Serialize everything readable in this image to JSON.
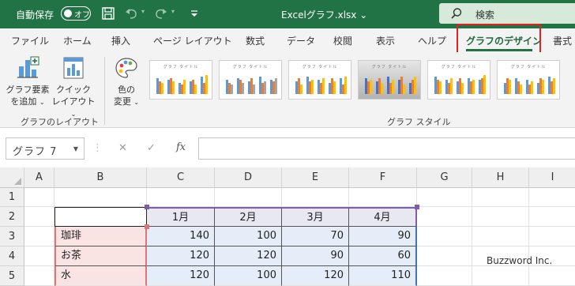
{
  "titlebar": {
    "autosave_label": "自動保存",
    "autosave_state": "オフ",
    "document_title": "Excelグラフ.xlsx",
    "title_chevron": "⌄",
    "search_label": "検索",
    "accent_color": "#217346"
  },
  "tabs": [
    {
      "label": "ファイル"
    },
    {
      "label": "ホーム"
    },
    {
      "label": "挿入"
    },
    {
      "label": "ページ レイアウト"
    },
    {
      "label": "数式"
    },
    {
      "label": "データ"
    },
    {
      "label": "校閲"
    },
    {
      "label": "表示"
    },
    {
      "label": "ヘルプ"
    },
    {
      "label": "グラフのデザイン",
      "active": true
    },
    {
      "label": "書式"
    }
  ],
  "ribbon": {
    "add_element_line1": "グラフ要素",
    "add_element_line2": "を追加",
    "quick_layout_line1": "クイック",
    "quick_layout_line2": "レイアウト",
    "change_colors_line1": "色の",
    "change_colors_line2": "変更",
    "group_layout_label": "グラフのレイアウト",
    "group_style_label": "グラフ スタイル",
    "style_thumb_title": "グラフ タイトル"
  },
  "formula_bar": {
    "name_box": "グラフ 7",
    "cancel_symbol": "✕",
    "enter_symbol": "✓",
    "fx_label": "fx",
    "formula_value": ""
  },
  "sheet": {
    "columns": [
      "A",
      "B",
      "C",
      "D",
      "E",
      "F",
      "G",
      "H",
      "I"
    ],
    "rows": [
      "1",
      "2",
      "3",
      "4",
      "5"
    ],
    "header_row": [
      "",
      "1月",
      "2月",
      "3月",
      "4月"
    ],
    "data": [
      {
        "label": "珈琲",
        "values": [
          "140",
          "100",
          "70",
          "90"
        ]
      },
      {
        "label": "お茶",
        "values": [
          "120",
          "120",
          "90",
          "60"
        ]
      },
      {
        "label": "水",
        "values": [
          "120",
          "100",
          "120",
          "110"
        ]
      }
    ]
  },
  "watermark": "Buzzword Inc."
}
